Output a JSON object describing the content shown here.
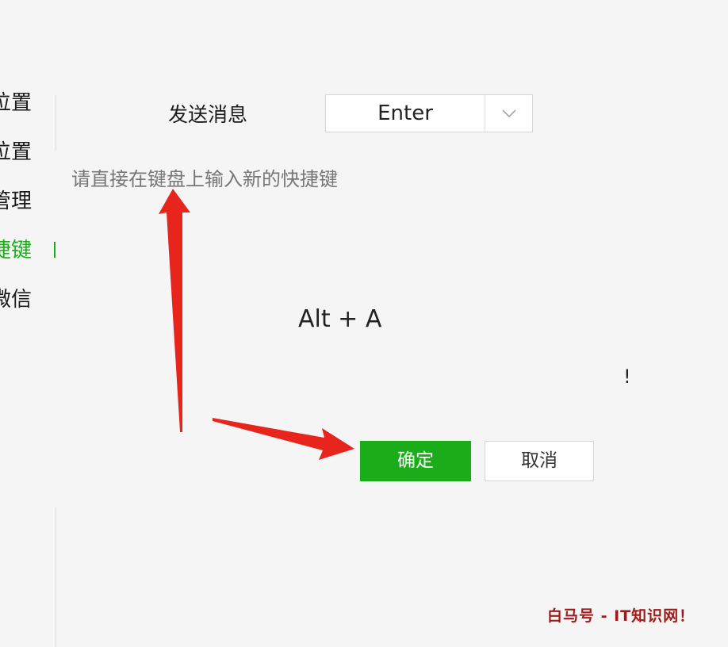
{
  "sidebar": {
    "items": [
      {
        "label": "位置"
      },
      {
        "label": "位置"
      },
      {
        "label": "管理"
      },
      {
        "label": "快捷键"
      },
      {
        "label": "微信"
      }
    ]
  },
  "shortcut_dialog": {
    "row_label": "发送消息",
    "key_value": "Enter",
    "hint": "请直接在键盘上输入新的快捷键",
    "captured_shortcut": "Alt + A",
    "mark": "!",
    "confirm_label": "确定",
    "cancel_label": "取消"
  },
  "watermark": "白马号 - IT知识网！",
  "colors": {
    "accent": "#1aad19",
    "annotation_arrow": "#e8251c",
    "watermark": "#a11a1a"
  }
}
